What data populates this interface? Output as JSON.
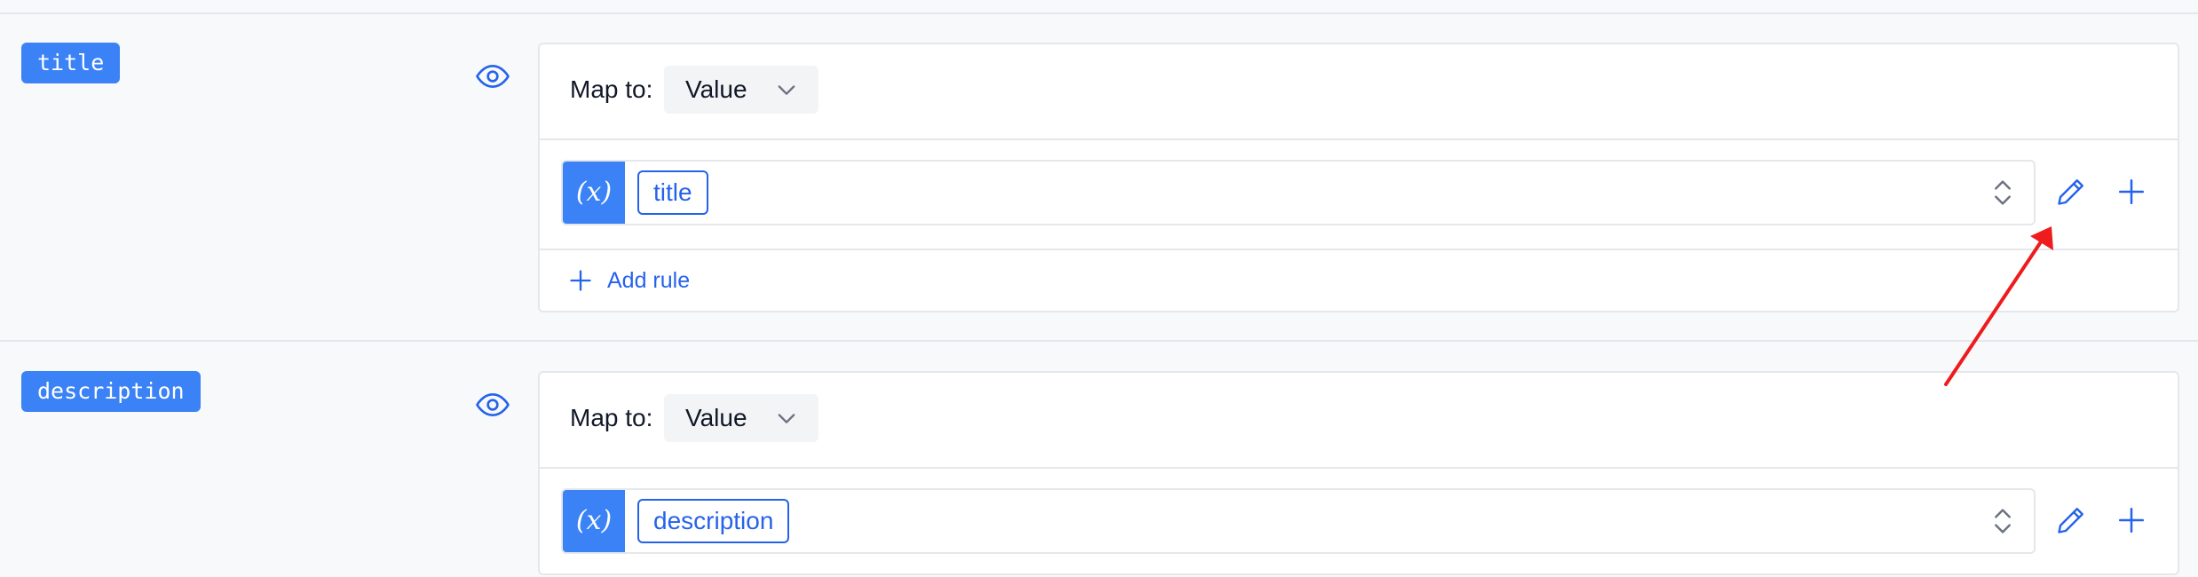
{
  "fields": [
    {
      "name": "title",
      "map_to_label": "Map to:",
      "map_to_value": "Value",
      "variable": "title",
      "variable_icon": "(x)",
      "add_rule_label": "Add rule"
    },
    {
      "name": "description",
      "map_to_label": "Map to:",
      "map_to_value": "Value",
      "variable": "description",
      "variable_icon": "(x)"
    }
  ],
  "icons": {
    "visibility": "eye-icon",
    "dropdown": "chevron-down-icon",
    "sort": "up-down-icon",
    "edit": "pencil-icon",
    "add": "plus-icon"
  },
  "colors": {
    "accent": "#3b82f6",
    "link": "#2563eb",
    "annotation_arrow": "#ee1c1c"
  }
}
